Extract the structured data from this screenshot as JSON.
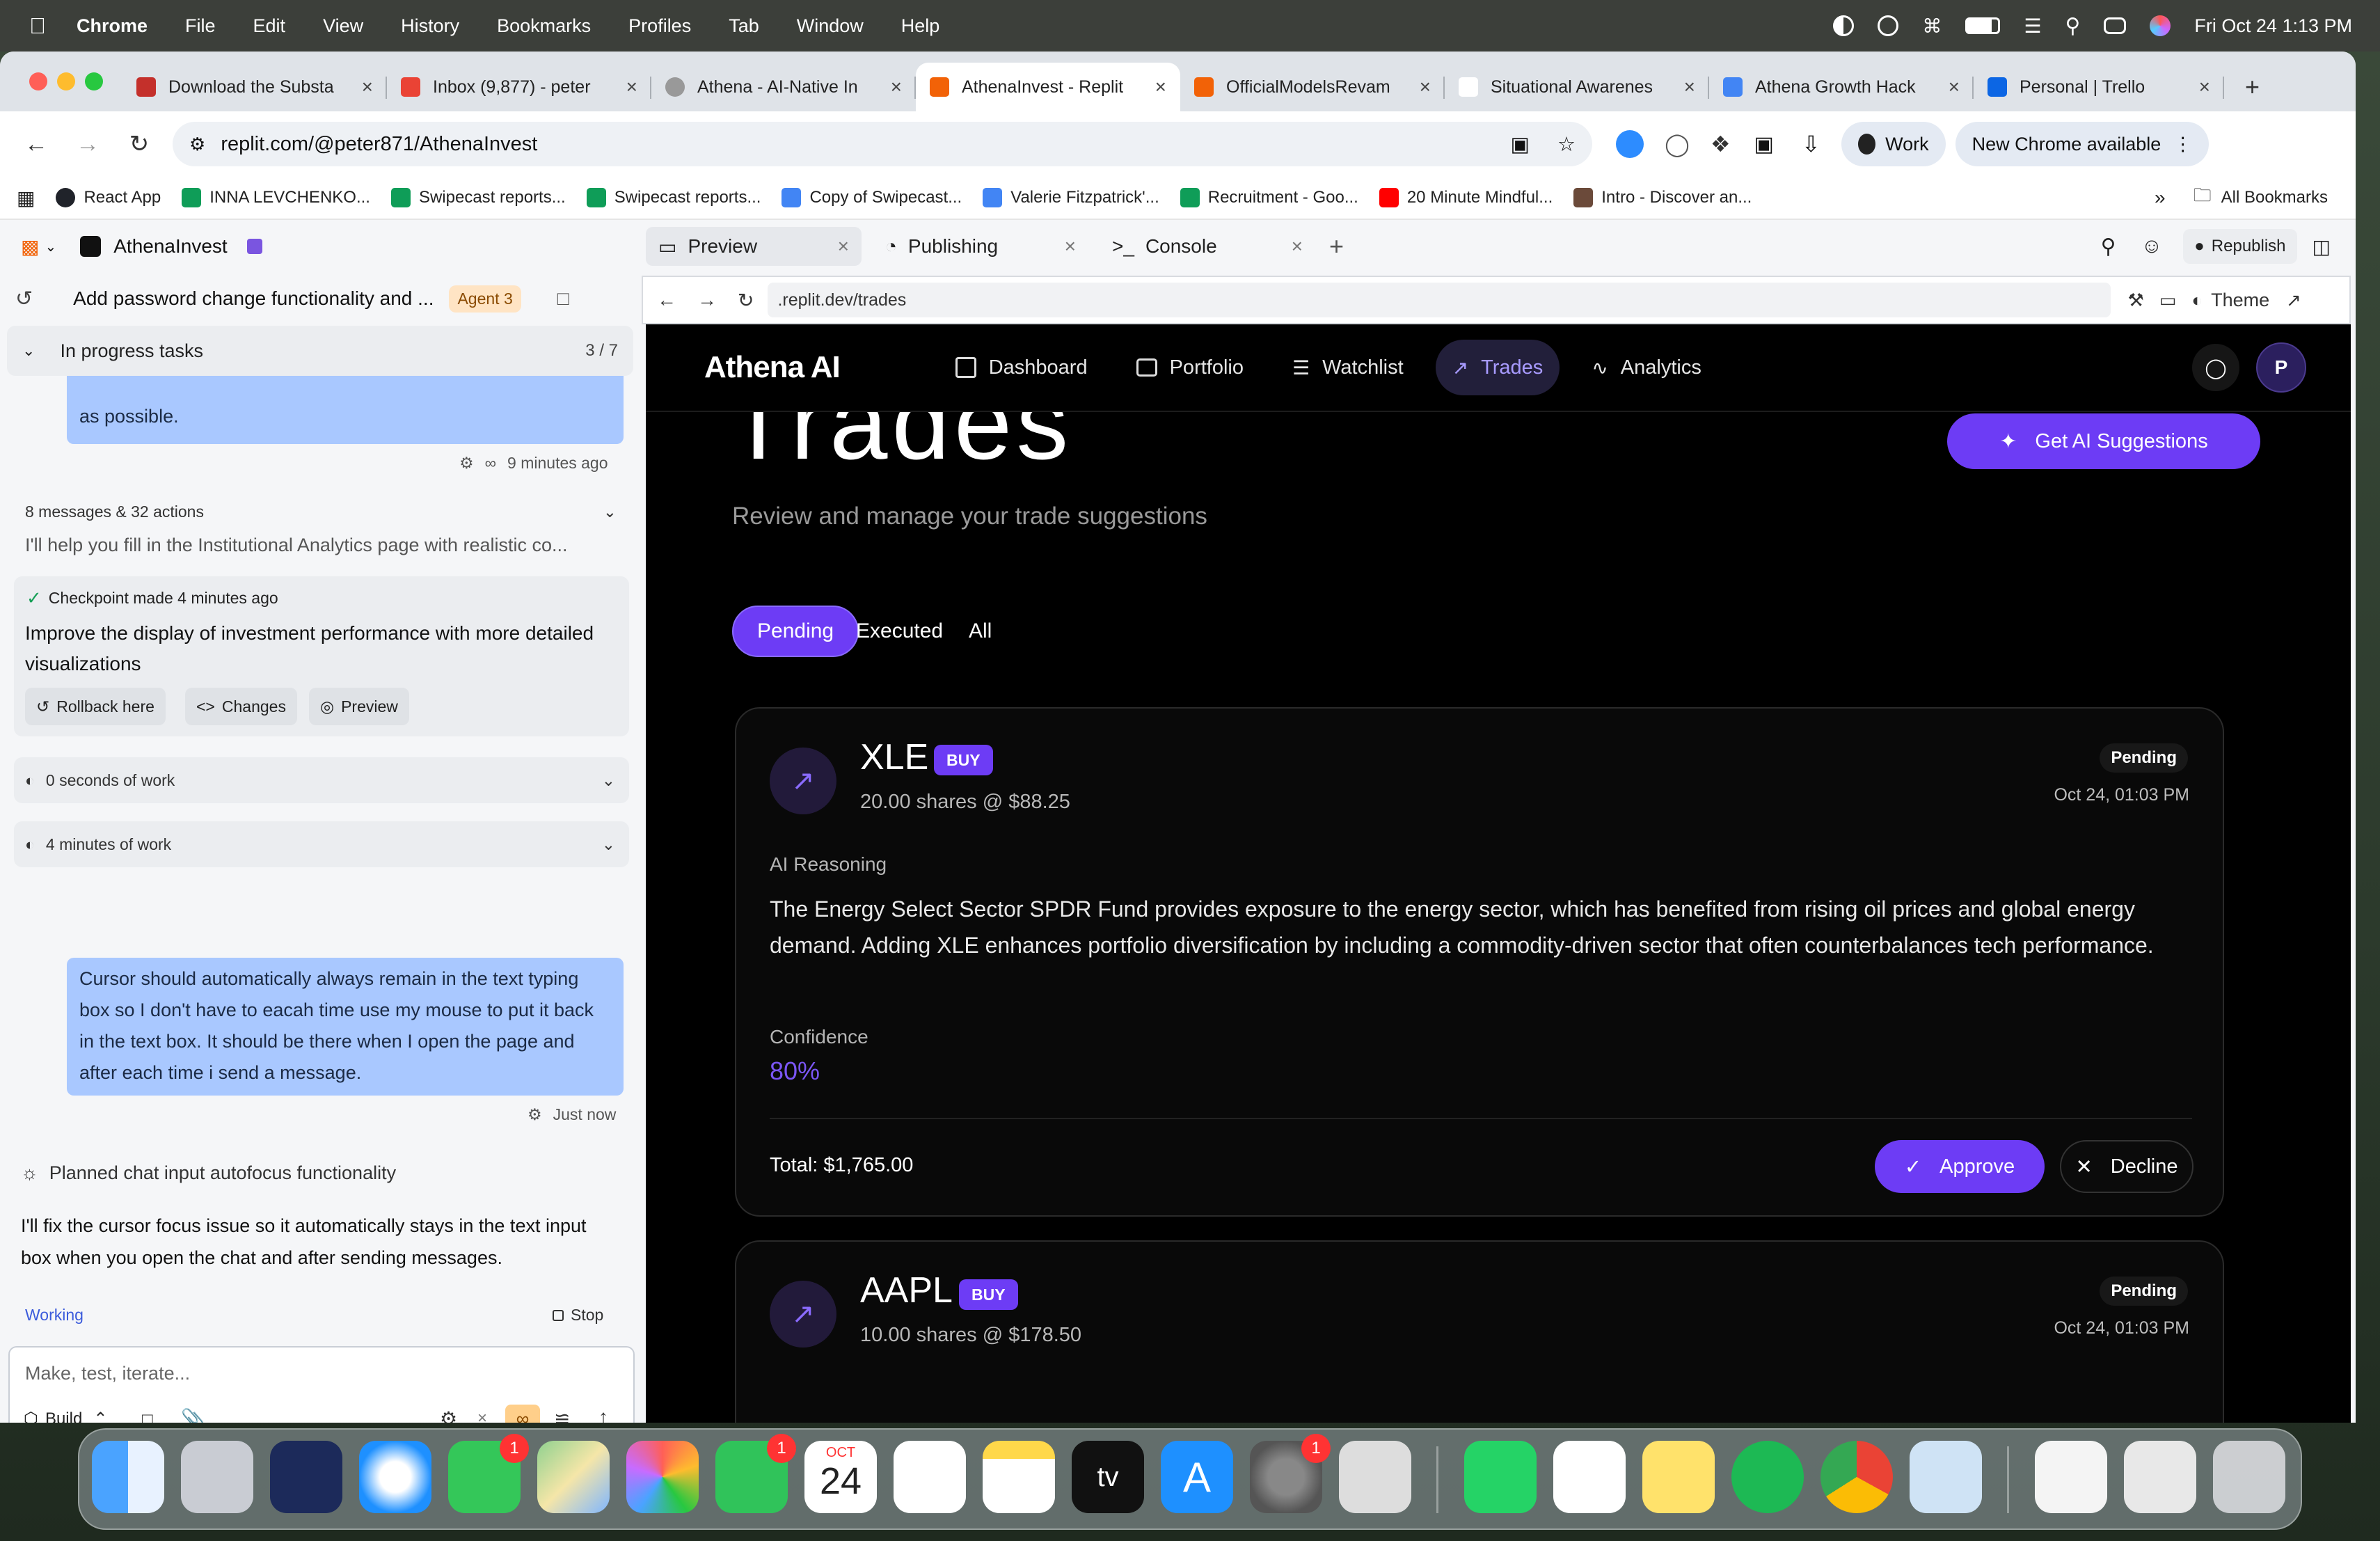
{
  "menubar": {
    "app": "Chrome",
    "items": [
      "File",
      "Edit",
      "View",
      "History",
      "Bookmarks",
      "Profiles",
      "Tab",
      "Window",
      "Help"
    ],
    "clock": "Fri Oct 24  1:13 PM"
  },
  "tabs": [
    {
      "title": "Download the Substa",
      "favicon_color": "#c4302b"
    },
    {
      "title": "Inbox (9,877) - peter",
      "favicon_color": "#ea4335"
    },
    {
      "title": "Athena - AI-Native In",
      "favicon_color": "#888888"
    },
    {
      "title": "AthenaInvest - Replit",
      "favicon_color": "#f26207",
      "active": true
    },
    {
      "title": "OfficialModelsRevam",
      "favicon_color": "#f26207"
    },
    {
      "title": "Situational Awarenes",
      "favicon_color": "#ffffff"
    },
    {
      "title": "Athena Growth Hack",
      "favicon_color": "#4285f4"
    },
    {
      "title": "Personal | Trello",
      "favicon_color": "#0c66e4"
    }
  ],
  "address": {
    "url": "replit.com/@peter871/AthenaInvest",
    "profile": "Work",
    "update": "New Chrome available"
  },
  "bookmarks": [
    {
      "label": "React App",
      "color": "#20232a"
    },
    {
      "label": "INNA LEVCHENKO...",
      "color": "#0f9d58"
    },
    {
      "label": "Swipecast reports...",
      "color": "#0f9d58"
    },
    {
      "label": "Swipecast reports...",
      "color": "#0f9d58"
    },
    {
      "label": "Copy of Swipecast...",
      "color": "#4285f4"
    },
    {
      "label": "Valerie Fitzpatrick'...",
      "color": "#4285f4"
    },
    {
      "label": "Recruitment - Goo...",
      "color": "#0f9d58"
    },
    {
      "label": "20 Minute Mindful...",
      "color": "#ff0000"
    },
    {
      "label": "Intro - Discover an...",
      "color": "#6b4a3a"
    }
  ],
  "all_bookmarks": "All Bookmarks",
  "replit": {
    "project": "AthenaInvest",
    "thread_title": "Add password change functionality and ...",
    "agent_badge": "Agent 3",
    "progress_label": "In progress tasks",
    "progress_count": "3 / 7",
    "bubble1_tail": "as possible.",
    "bubble1_time": "9 minutes ago",
    "messages_summary": "8 messages & 32 actions",
    "messages_preview": "I'll help you fill in the Institutional Analytics page with realistic co...",
    "checkpoint_label": "Checkpoint made 4 minutes ago",
    "checkpoint_text": "Improve the display of investment performance with more detailed visualizations",
    "rollback": "Rollback here",
    "changes": "Changes",
    "preview": "Preview",
    "work1": "0 seconds of work",
    "work2": "4 minutes of work",
    "user_message": "Cursor should automatically always remain in the text typing box so I don't have to eacah time use my mouse to put it back in the text box. It should be there when I open the page and after each time i send a message.",
    "user_time": "Just now",
    "planned": "Planned chat input autofocus functionality",
    "agent_reply": "I'll fix the cursor focus issue so it automatically stays in the text input box when you open the chat and after sending messages.",
    "working": "Working",
    "stop": "Stop",
    "input_placeholder": "Make, test, iterate...",
    "build": "Build"
  },
  "panes": {
    "tabs": [
      "Preview",
      "Publishing",
      "Console"
    ],
    "republish": "Republish",
    "url": ".replit.dev/trades",
    "theme": "Theme"
  },
  "site": {
    "brand": "Athena AI",
    "nav": [
      "Dashboard",
      "Portfolio",
      "Watchlist",
      "Trades",
      "Analytics"
    ],
    "active_nav": "Trades",
    "avatar": "P",
    "page_title": "Trades",
    "page_subtitle": "Review and manage your trade suggestions",
    "cta": "Get AI Suggestions",
    "filters": [
      "Pending",
      "Executed",
      "All"
    ],
    "trades": [
      {
        "symbol": "XLE",
        "side": "BUY",
        "shares": "20.00 shares @ $88.25",
        "status": "Pending",
        "date": "Oct 24, 01:03 PM",
        "reasoning_label": "AI Reasoning",
        "reasoning": "The Energy Select Sector SPDR Fund provides exposure to the energy sector, which has benefited from rising oil prices and global energy demand. Adding XLE enhances portfolio diversification by including a commodity-driven sector that often counterbalances tech performance.",
        "confidence_label": "Confidence",
        "confidence": "80%",
        "total": "Total: $1,765.00",
        "approve": "Approve",
        "decline": "Decline"
      },
      {
        "symbol": "AAPL",
        "side": "BUY",
        "shares": "10.00 shares @ $178.50",
        "status": "Pending",
        "date": "Oct 24, 01:03 PM"
      }
    ],
    "accent": "#6d3cf5"
  },
  "dock": {
    "calendar_month": "OCT",
    "calendar_day": "24",
    "tv": "tv",
    "badges": [
      "1",
      "1",
      "1"
    ]
  }
}
